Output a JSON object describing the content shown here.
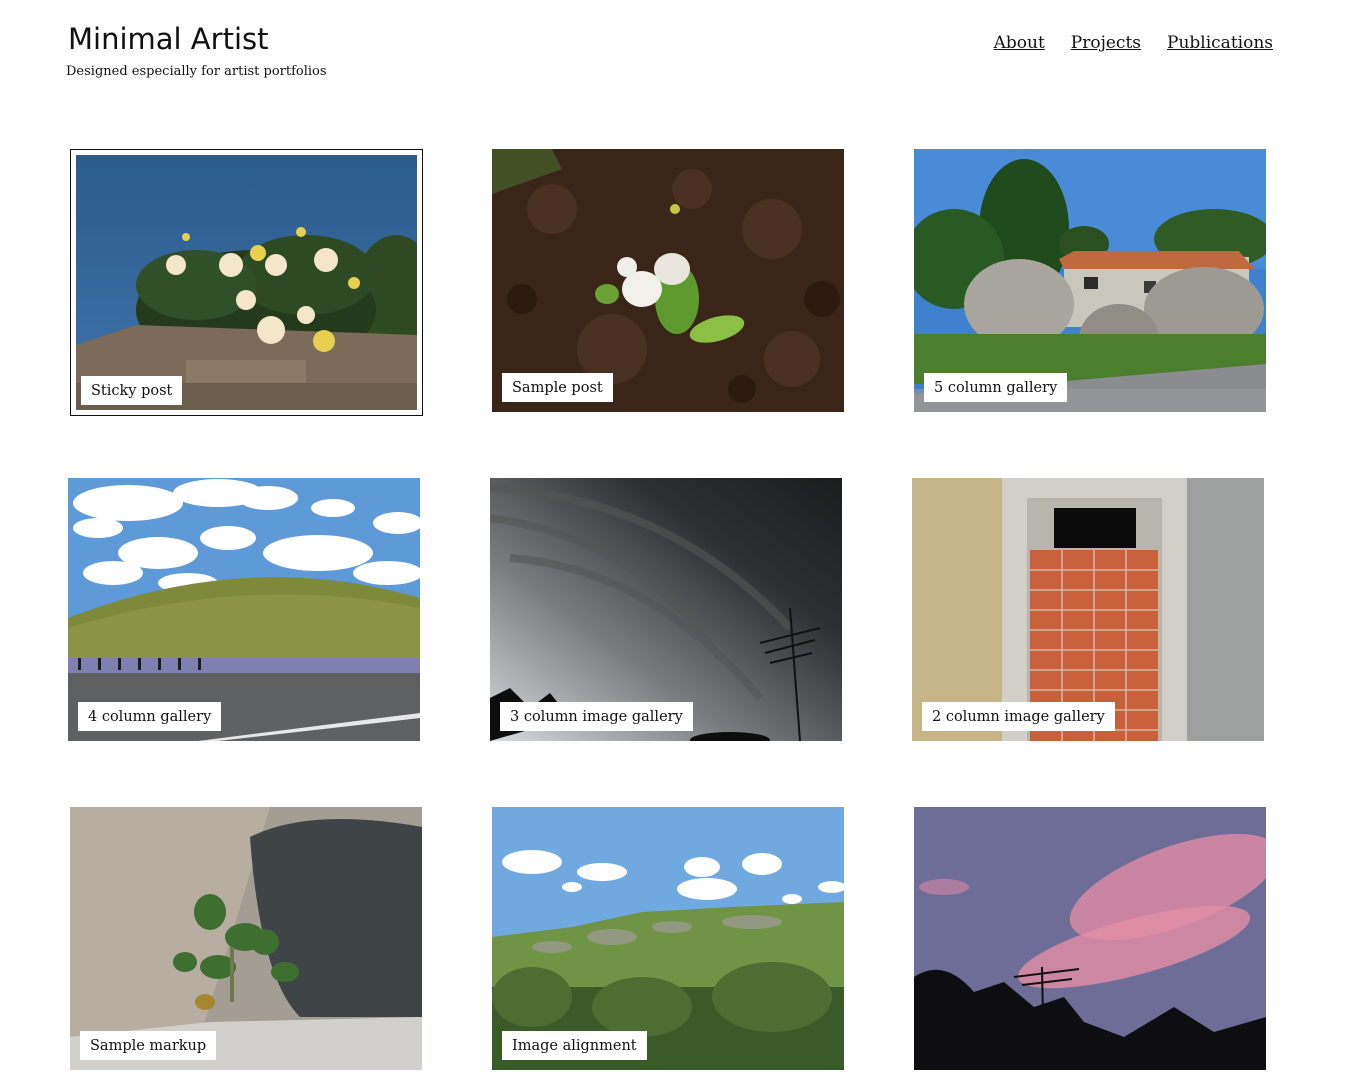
{
  "site": {
    "title": "Minimal Artist",
    "description": "Designed especially for artist portfolios"
  },
  "nav": [
    {
      "label": "About"
    },
    {
      "label": "Projects"
    },
    {
      "label": "Publications"
    }
  ],
  "posts": [
    {
      "label": "Sticky post",
      "image": "yellow-roses-on-stone-wall"
    },
    {
      "label": "Sample post",
      "image": "white-flower-seedling-in-soil"
    },
    {
      "label": "5 column gallery",
      "image": "house-between-boulders"
    },
    {
      "label": "4 column gallery",
      "image": "green-hill-with-clouds"
    },
    {
      "label": "3 column image gallery",
      "image": "storm-clouds-with-antenna"
    },
    {
      "label": "2 column image gallery",
      "image": "bricked-up-window"
    },
    {
      "label": "Sample markup",
      "image": "plant-in-rock-crack"
    },
    {
      "label": "Image alignment",
      "image": "rocky-hillside-landscape"
    },
    {
      "label": "",
      "image": "pink-sunset-sky"
    }
  ]
}
